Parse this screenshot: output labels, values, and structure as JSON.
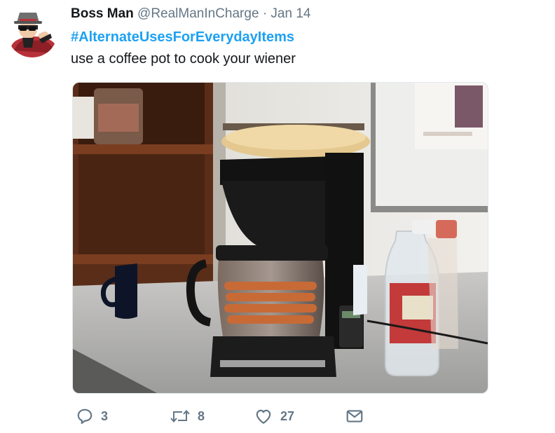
{
  "tweet": {
    "display_name": "Boss Man",
    "handle": "@RealManInCharge",
    "separator": "·",
    "date": "Jan 14",
    "hashtag": "#AlternateUsesForEverydayItems",
    "text": "use a coffee pot to cook your wiener"
  },
  "actions": {
    "replies": "3",
    "retweets": "8",
    "likes": "27"
  },
  "icons": {
    "reply": "reply-icon",
    "retweet": "retweet-icon",
    "like": "heart-icon",
    "message": "envelope-icon"
  },
  "colors": {
    "link": "#1da1f2",
    "secondary_text": "#657786",
    "primary_text": "#14171a"
  }
}
